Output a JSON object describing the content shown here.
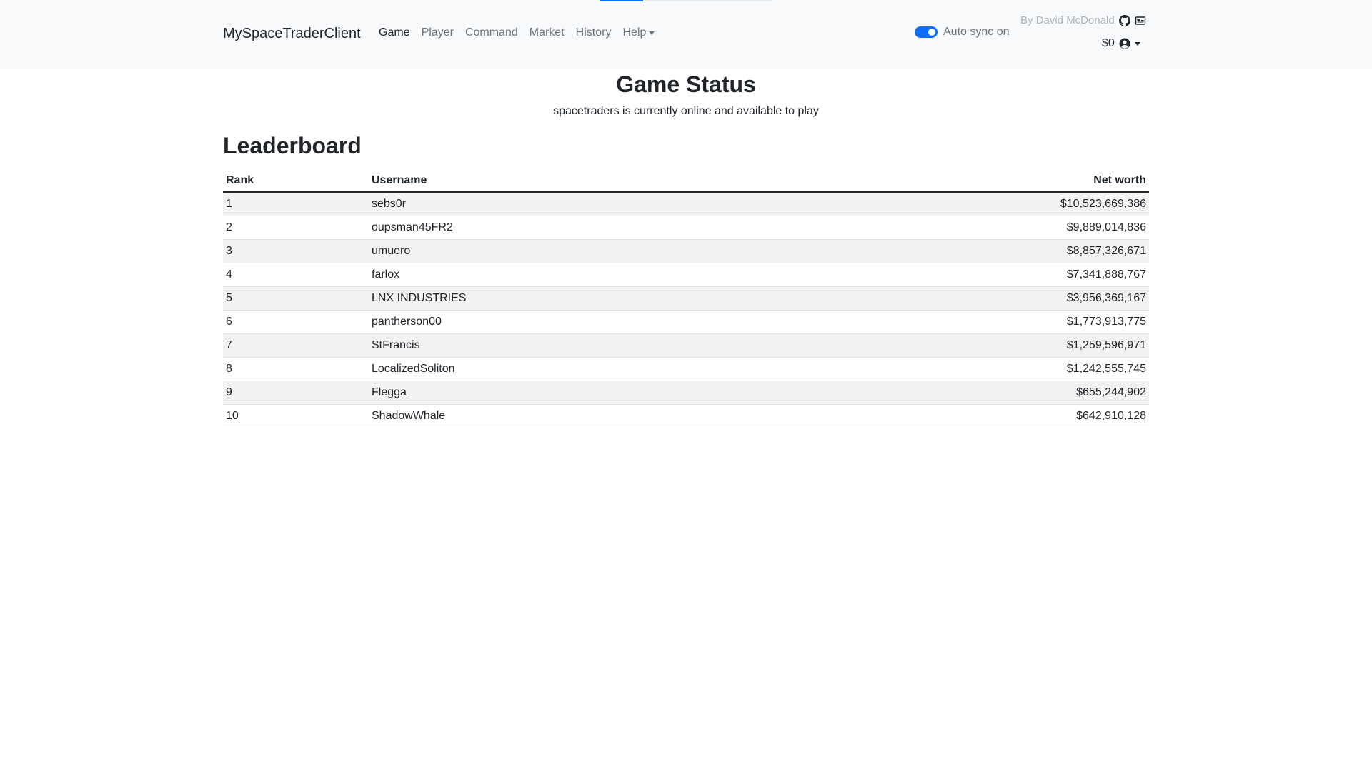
{
  "navbar": {
    "sync_progress": 0.25,
    "brand": "MySpaceTraderClient",
    "links": [
      {
        "label": "Game",
        "active": true
      },
      {
        "label": "Player",
        "active": false
      },
      {
        "label": "Command",
        "active": false
      },
      {
        "label": "Market",
        "active": false
      },
      {
        "label": "History",
        "active": false
      },
      {
        "label": "Help",
        "active": false,
        "dropdown": true
      }
    ],
    "auto_sync": {
      "label": "Auto sync on",
      "enabled": true
    },
    "byline": "By David McDonald",
    "icons": [
      "github-icon",
      "newspaper-icon",
      "user-circle-icon"
    ],
    "credits": "$0"
  },
  "game_status": {
    "title": "Game Status",
    "message": "spacetraders is currently online and available to play"
  },
  "leaderboard": {
    "title": "Leaderboard",
    "columns": [
      "Rank",
      "Username",
      "Net worth"
    ],
    "rows": [
      {
        "rank": "1",
        "username": "sebs0r",
        "net_worth": "$10,523,669,386"
      },
      {
        "rank": "2",
        "username": "oupsman45FR2",
        "net_worth": "$9,889,014,836"
      },
      {
        "rank": "3",
        "username": "umuero",
        "net_worth": "$8,857,326,671"
      },
      {
        "rank": "4",
        "username": "farlox",
        "net_worth": "$7,341,888,767"
      },
      {
        "rank": "5",
        "username": "LNX INDUSTRIES",
        "net_worth": "$3,956,369,167"
      },
      {
        "rank": "6",
        "username": "pantherson00",
        "net_worth": "$1,773,913,775"
      },
      {
        "rank": "7",
        "username": "StFrancis",
        "net_worth": "$1,259,596,971"
      },
      {
        "rank": "8",
        "username": "LocalizedSoliton",
        "net_worth": "$1,242,555,745"
      },
      {
        "rank": "9",
        "username": "Flegga",
        "net_worth": "$655,244,902"
      },
      {
        "rank": "10",
        "username": "ShadowWhale",
        "net_worth": "$642,910,128"
      }
    ]
  },
  "colors": {
    "accent": "#0d6efd",
    "navbar_bg": "#f8f9fa",
    "text": "#212529",
    "muted": "#6c757d",
    "stripe": "#f2f2f2"
  }
}
